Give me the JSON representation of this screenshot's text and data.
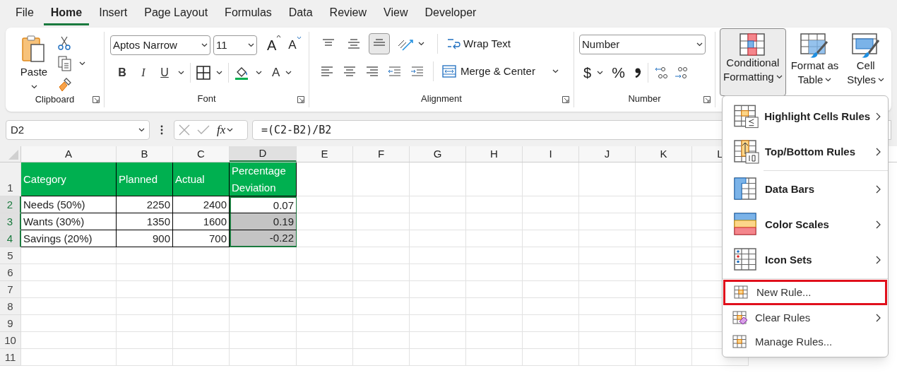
{
  "tabs": [
    {
      "label": "File",
      "selected": false
    },
    {
      "label": "Home",
      "selected": true
    },
    {
      "label": "Insert",
      "selected": false
    },
    {
      "label": "Page Layout",
      "selected": false
    },
    {
      "label": "Formulas",
      "selected": false
    },
    {
      "label": "Data",
      "selected": false
    },
    {
      "label": "Review",
      "selected": false
    },
    {
      "label": "View",
      "selected": false
    },
    {
      "label": "Developer",
      "selected": false
    }
  ],
  "ribbon": {
    "clipboard": {
      "paste_label": "Paste",
      "group_label": "Clipboard"
    },
    "font": {
      "font_name": "Aptos Narrow",
      "font_size": "11",
      "grow_label": "A",
      "shrink_label": "A",
      "buttons": [
        {
          "kind": "bold",
          "label": "B"
        },
        {
          "kind": "italic",
          "label": "I"
        },
        {
          "kind": "underline",
          "label": "U"
        }
      ],
      "font_color_label": "A",
      "group_label": "Font"
    },
    "alignment": {
      "top_buttons": [
        {
          "kind": "top",
          "selected": false
        },
        {
          "kind": "middle",
          "selected": false
        },
        {
          "kind": "bottom",
          "selected": true
        }
      ],
      "wrap_text": "Wrap Text",
      "merge": "Merge & Center",
      "group_label": "Alignment"
    },
    "number": {
      "format": "Number",
      "currency_symbol": "$",
      "percent_symbol": "%",
      "group_label": "Number"
    },
    "styles": [
      {
        "kind": "conditional",
        "lines": [
          "Conditional",
          "Formatting"
        ],
        "selected": true
      },
      {
        "kind": "table",
        "lines": [
          "Format as",
          "Table"
        ],
        "selected": false
      },
      {
        "kind": "cell",
        "lines": [
          "Cell",
          "Styles"
        ],
        "selected": false
      }
    ]
  },
  "formula_bar": {
    "name_box": "D2",
    "fx": "fx",
    "formula": "=(C2-B2)/B2"
  },
  "sheet": {
    "columns": [
      {
        "label": "A",
        "selected": false
      },
      {
        "label": "B",
        "selected": false
      },
      {
        "label": "C",
        "selected": false
      },
      {
        "label": "D",
        "selected": true
      },
      {
        "label": "E",
        "selected": false
      },
      {
        "label": "F",
        "selected": false
      },
      {
        "label": "G",
        "selected": false
      },
      {
        "label": "H",
        "selected": false
      },
      {
        "label": "I",
        "selected": false
      },
      {
        "label": "J",
        "selected": false
      },
      {
        "label": "K",
        "selected": false
      },
      {
        "label": "L",
        "selected": false
      }
    ],
    "rows": [
      {
        "label": "1",
        "selected": false,
        "cells": [
          {
            "text": "Category",
            "kind": "header"
          },
          {
            "text": "Planned",
            "kind": "header"
          },
          {
            "text": "Actual",
            "kind": "header"
          },
          {
            "text": "Percentage Deviation",
            "kind": "header"
          }
        ]
      },
      {
        "label": "2",
        "selected": true,
        "cells": [
          {
            "text": "Needs (50%)",
            "kind": "text",
            "highlighted": false
          },
          {
            "text": "2250",
            "kind": "number",
            "highlighted": false
          },
          {
            "text": "2400",
            "kind": "number",
            "highlighted": false
          },
          {
            "text": "0.07",
            "kind": "number",
            "highlighted": false
          }
        ]
      },
      {
        "label": "3",
        "selected": true,
        "cells": [
          {
            "text": "Wants (30%)",
            "kind": "text",
            "highlighted": false
          },
          {
            "text": "1350",
            "kind": "number",
            "highlighted": false
          },
          {
            "text": "1600",
            "kind": "number",
            "highlighted": false
          },
          {
            "text": "0.19",
            "kind": "number",
            "highlighted": true
          }
        ]
      },
      {
        "label": "4",
        "selected": true,
        "cells": [
          {
            "text": "Savings (20%)",
            "kind": "text",
            "highlighted": false
          },
          {
            "text": "900",
            "kind": "number",
            "highlighted": false
          },
          {
            "text": "700",
            "kind": "number",
            "highlighted": false
          },
          {
            "text": "-0.22",
            "kind": "number",
            "highlighted": true
          }
        ]
      },
      {
        "label": "5",
        "selected": false,
        "cells": []
      },
      {
        "label": "6",
        "selected": false,
        "cells": []
      },
      {
        "label": "7",
        "selected": false,
        "cells": []
      },
      {
        "label": "8",
        "selected": false,
        "cells": []
      },
      {
        "label": "9",
        "selected": false,
        "cells": []
      },
      {
        "label": "10",
        "selected": false,
        "cells": []
      },
      {
        "label": "11",
        "selected": false,
        "cells": []
      }
    ]
  },
  "menu": {
    "sections": [
      {
        "kind": "large",
        "items": [
          {
            "kind": "highlight",
            "label": "Highlight Cells Rules",
            "submenu": true,
            "outlined": false
          },
          {
            "kind": "topbottom",
            "label": "Top/Bottom Rules",
            "submenu": true,
            "outlined": false
          }
        ]
      },
      {
        "kind": "large",
        "items": [
          {
            "kind": "databars",
            "label": "Data Bars",
            "submenu": true,
            "outlined": false
          },
          {
            "kind": "colorscales",
            "label": "Color Scales",
            "submenu": true,
            "outlined": false
          },
          {
            "kind": "iconsets",
            "label": "Icon Sets",
            "submenu": true,
            "outlined": false
          }
        ]
      },
      {
        "kind": "small",
        "items": [
          {
            "kind": "newrule",
            "label": "New Rule...",
            "submenu": false,
            "outlined": true
          },
          {
            "kind": "clear",
            "label": "Clear Rules",
            "submenu": true,
            "outlined": false
          },
          {
            "kind": "manage",
            "label": "Manage Rules...",
            "submenu": false,
            "outlined": false
          }
        ]
      }
    ]
  }
}
